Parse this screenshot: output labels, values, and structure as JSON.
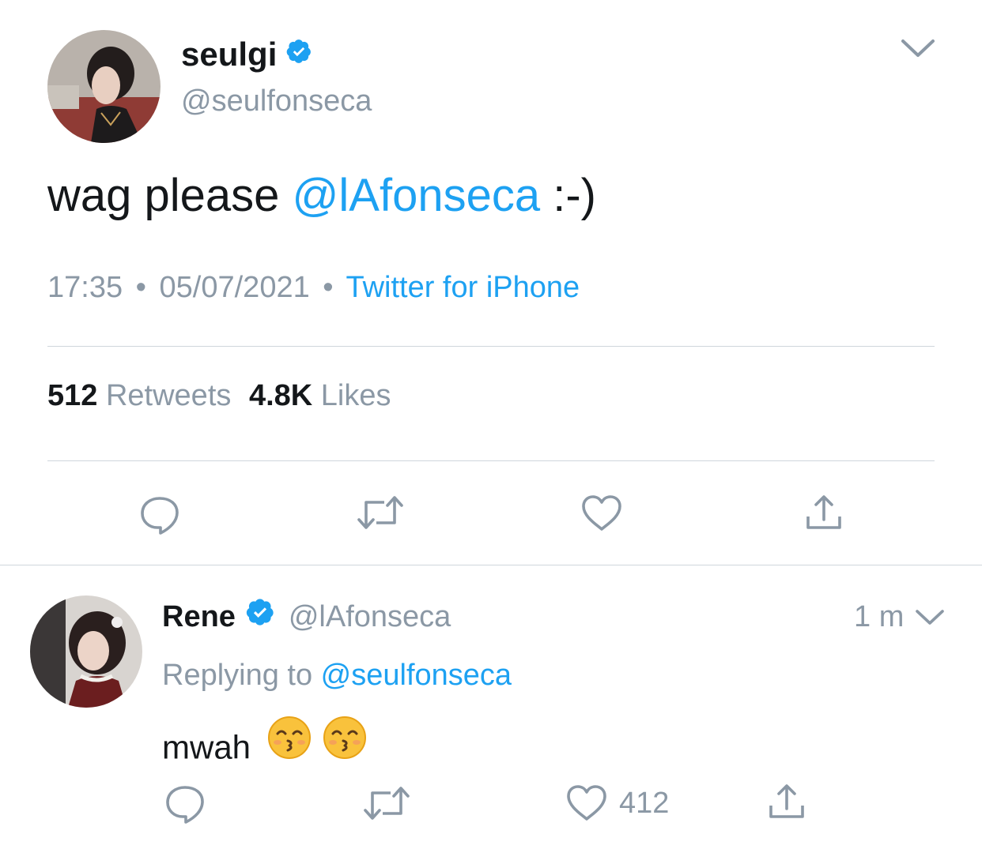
{
  "main_tweet": {
    "display_name": "seulgi",
    "handle": "@seulfonseca",
    "text_prefix": "wag please ",
    "mention": "@lAfonseca",
    "text_suffix": " :-)",
    "time": "17:35",
    "separator": "•",
    "date": "05/07/2021",
    "source": "Twitter for iPhone",
    "retweets_count": "512",
    "retweets_label": "Retweets",
    "likes_count": "4.8K",
    "likes_label": "Likes",
    "icons": [
      "reply-icon",
      "retweet-icon",
      "like-icon",
      "share-icon",
      "chevron-down-icon",
      "verified-icon"
    ]
  },
  "reply": {
    "display_name": "Rene",
    "handle": "@lAfonseca",
    "time_ago": "1 m",
    "replying_label": "Replying to ",
    "replying_to": "@seulfonseca",
    "text": "mwah",
    "emojis": [
      "kissing-face-with-smiling-eyes",
      "kissing-face-with-smiling-eyes"
    ],
    "like_count": "412"
  },
  "colors": {
    "link": "#1da1f2",
    "secondary": "#8b98a5",
    "primary_text": "#14171a",
    "divider": "#cfd6dc"
  }
}
